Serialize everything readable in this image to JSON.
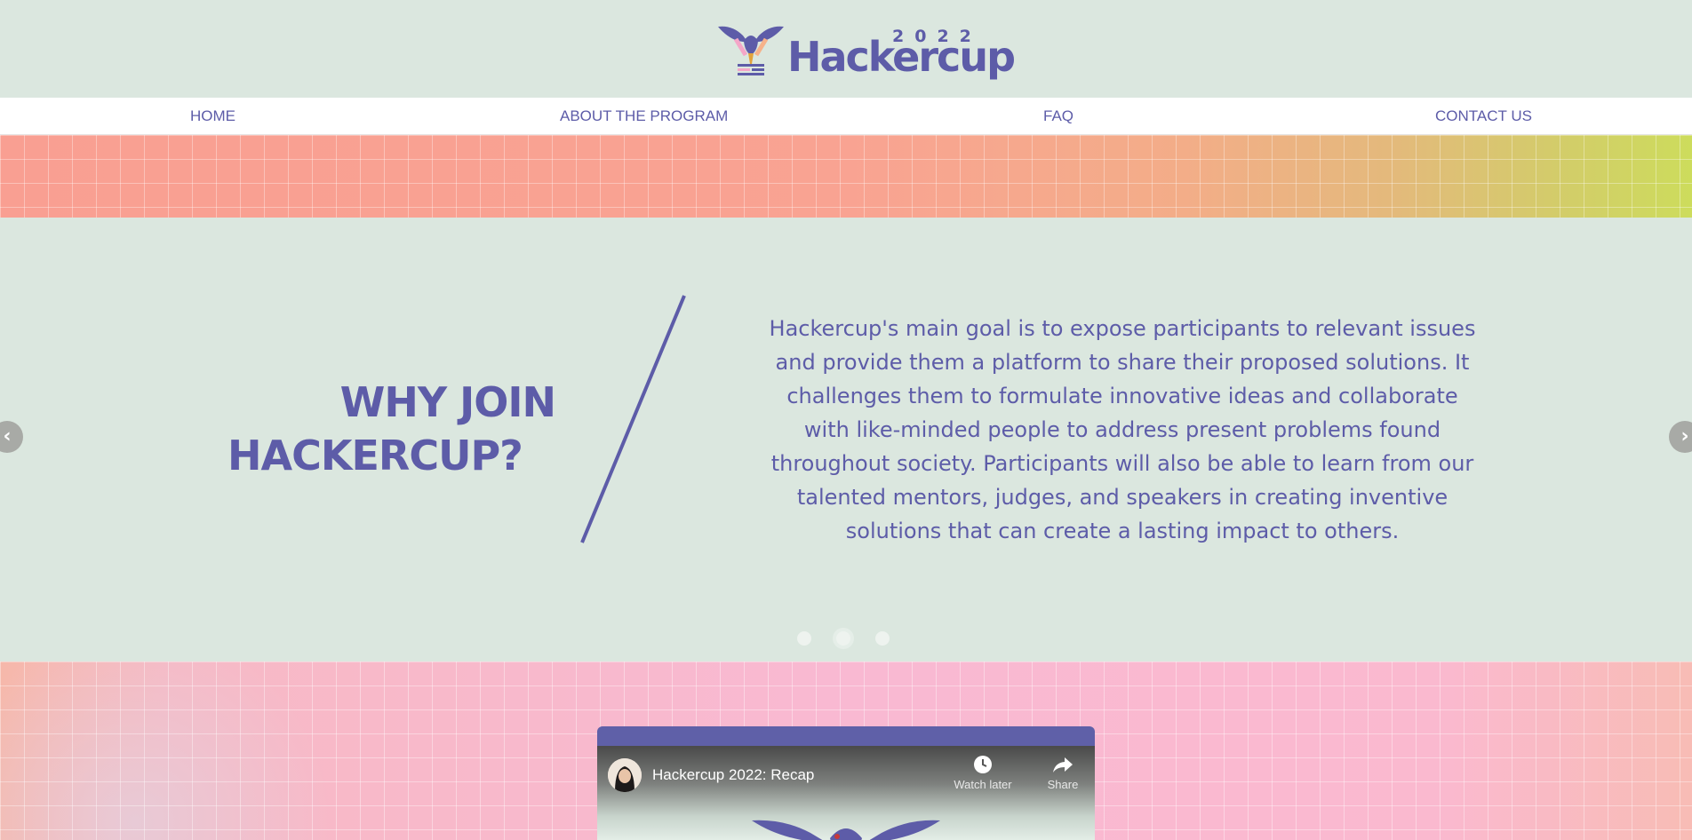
{
  "logo": {
    "year": "2022",
    "wordmark": "Hackercup",
    "icon": "trophy-bird-icon"
  },
  "nav": {
    "items": [
      {
        "label": "HOME"
      },
      {
        "label": "ABOUT THE PROGRAM"
      },
      {
        "label": "FAQ"
      },
      {
        "label": "CONTACT US"
      }
    ]
  },
  "slide": {
    "heading_line1": "WHY JOIN",
    "heading_line2": "HACKERCUP?",
    "body": "Hackercup's main goal is to expose participants to relevant issues and provide them a platform to share their proposed solutions. It challenges them to formulate innovative ideas and collaborate with like-minded people to address present problems found throughout society. Participants will also be able to learn from our talented mentors, judges, and speakers in creating inventive solutions that can create a lasting impact to others.",
    "prev_icon": "chevron-left-icon",
    "next_icon": "chevron-right-icon",
    "dots_count": 3,
    "active_dot": 2
  },
  "video": {
    "title": "Hackercup 2022: Recap",
    "watch_later": "Watch later",
    "share": "Share"
  },
  "colors": {
    "brand_purple": "#5d5ca8",
    "page_bg": "#dbe7df",
    "coral": "#f99f92",
    "lime": "#cddc5c",
    "pink": "#f9b9d2"
  }
}
